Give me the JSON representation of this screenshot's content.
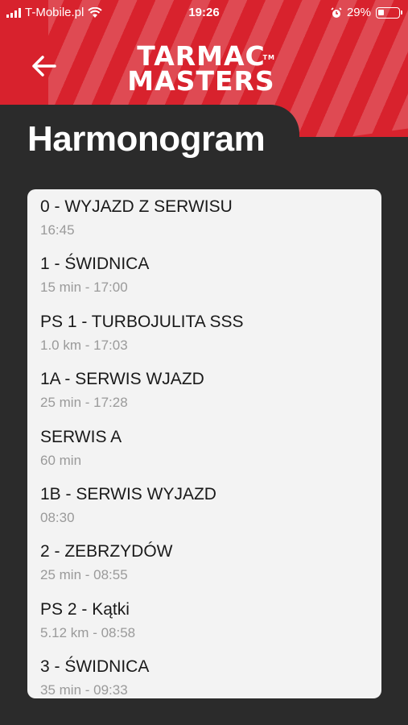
{
  "status_bar": {
    "carrier": "T-Mobile.pl",
    "time": "19:26",
    "battery_percent": "29%",
    "battery_level": 0.29
  },
  "header": {
    "logo_line1": "TARMAC",
    "logo_line2": "MASTERS",
    "logo_tm": "TM",
    "title": "Harmonogram",
    "accent_color": "#d8222d"
  },
  "schedule": [
    {
      "title": "0 - WYJAZD Z SERWISU",
      "subtitle": "16:45"
    },
    {
      "title": "1 - ŚWIDNICA",
      "subtitle": "15 min - 17:00"
    },
    {
      "title": "PS 1 - TURBOJULITA SSS",
      "subtitle": "1.0 km - 17:03"
    },
    {
      "title": "1A - SERWIS WJAZD",
      "subtitle": "25 min - 17:28"
    },
    {
      "title": "SERWIS A",
      "subtitle": "60 min"
    },
    {
      "title": "1B - SERWIS WYJAZD",
      "subtitle": "08:30"
    },
    {
      "title": "2 - ZEBRZYDÓW",
      "subtitle": "25 min - 08:55"
    },
    {
      "title": "PS 2 - Kątki",
      "subtitle": "5.12 km - 08:58"
    },
    {
      "title": "3 - ŚWIDNICA",
      "subtitle": "35 min - 09:33"
    }
  ]
}
